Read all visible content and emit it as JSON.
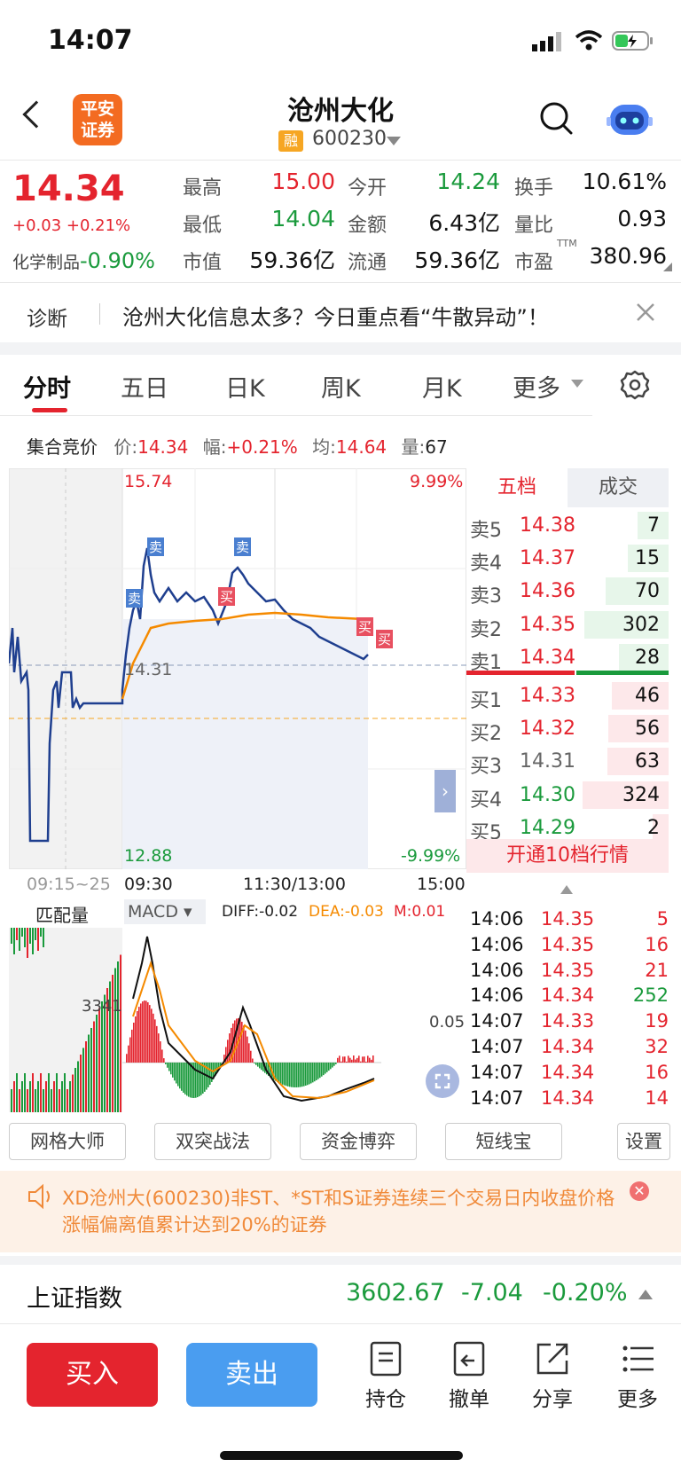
{
  "status": {
    "time": "14:07"
  },
  "header": {
    "logo": "平安\n证券",
    "logo_l1": "平安",
    "logo_l2": "证券",
    "title": "沧州大化",
    "rong": "融",
    "code": "600230"
  },
  "quote": {
    "price": "14.34",
    "change": "+0.03 +0.21%",
    "sector": "化学制品",
    "sector_pct": "-0.90%",
    "rows": [
      [
        {
          "label": "最高",
          "value": "15.00",
          "color": "red"
        },
        {
          "label": "今开",
          "value": "14.24",
          "color": "green"
        },
        {
          "label": "换手",
          "value": "10.61%",
          "color": "dark"
        }
      ],
      [
        {
          "label": "最低",
          "value": "14.04",
          "color": "green"
        },
        {
          "label": "金额",
          "value": "6.43亿",
          "color": "dark"
        },
        {
          "label": "量比",
          "value": "0.93",
          "color": "dark"
        }
      ],
      [
        {
          "label": "市值",
          "value": "59.36亿",
          "color": "dark"
        },
        {
          "label": "流通",
          "value": "59.36亿",
          "color": "dark"
        },
        {
          "label": "市盈",
          "value": "380.96",
          "color": "dark"
        }
      ]
    ],
    "ttm": "TTM"
  },
  "diagnosis": {
    "label": "诊断",
    "text": "沧州大化信息太多？今日重点看“牛散异动”！"
  },
  "tabs": [
    "分时",
    "五日",
    "日K",
    "周K",
    "月K",
    "更多"
  ],
  "info": {
    "title": "集合竞价",
    "price_label": "价:",
    "price": "14.34",
    "amp_label": "幅:",
    "amp": "+0.21%",
    "avg_label": "均:",
    "avg": "14.64",
    "vol_label": "量:",
    "vol": "67"
  },
  "chart": {
    "top": "15.74",
    "top_pct": "9.99%",
    "bottom": "12.88",
    "bottom_pct": "-9.99%",
    "ref": "14.31",
    "x_pre": "09:15~25",
    "x_open": "09:30",
    "x_mid": "11:30/13:00",
    "x_close": "15:00",
    "markers": {
      "sell": "卖",
      "buy": "买"
    }
  },
  "macd": {
    "tab1": "匹配量",
    "tab2": "MACD",
    "diff": "DIFF:-0.02",
    "dea": "DEA:-0.03",
    "m": "M:0.01",
    "vol_label": "3341",
    "scale": "0.05"
  },
  "orderbook": {
    "tab1": "五档",
    "tab2": "成交",
    "asks": [
      {
        "label": "卖5",
        "price": "14.38",
        "vol": "7"
      },
      {
        "label": "卖4",
        "price": "14.37",
        "vol": "15"
      },
      {
        "label": "卖3",
        "price": "14.36",
        "vol": "70"
      },
      {
        "label": "卖2",
        "price": "14.35",
        "vol": "302"
      },
      {
        "label": "卖1",
        "price": "14.34",
        "vol": "28"
      }
    ],
    "bids": [
      {
        "label": "买1",
        "price": "14.33",
        "vol": "46"
      },
      {
        "label": "买2",
        "price": "14.32",
        "vol": "56"
      },
      {
        "label": "买3",
        "price": "14.31",
        "vol": "63"
      },
      {
        "label": "买4",
        "price": "14.30",
        "vol": "324"
      },
      {
        "label": "买5",
        "price": "14.29",
        "vol": "2"
      }
    ],
    "open10": "开通10档行情"
  },
  "ticks": [
    {
      "t": "14:06",
      "p": "14.35",
      "v": "5"
    },
    {
      "t": "14:06",
      "p": "14.35",
      "v": "16"
    },
    {
      "t": "14:06",
      "p": "14.35",
      "v": "21"
    },
    {
      "t": "14:06",
      "p": "14.34",
      "v": "252"
    },
    {
      "t": "14:07",
      "p": "14.33",
      "v": "19"
    },
    {
      "t": "14:07",
      "p": "14.34",
      "v": "32"
    },
    {
      "t": "14:07",
      "p": "14.34",
      "v": "16"
    },
    {
      "t": "14:07",
      "p": "14.34",
      "v": "14"
    }
  ],
  "tools": [
    "网格大师",
    "双突战法",
    "资金博弈",
    "短线宝",
    "设置"
  ],
  "notice": "XD沧州大(600230)非ST、*ST和S证券连续三个交易日内收盘价格涨幅偏离值累计达到20%的证券",
  "index": {
    "name": "上证指数",
    "value": "3602.67",
    "chg": "-7.04",
    "pct": "-0.20%"
  },
  "bottom": {
    "buy": "买入",
    "sell": "卖出",
    "hold": "持仓",
    "cancel": "撤单",
    "share": "分享",
    "more": "更多"
  }
}
